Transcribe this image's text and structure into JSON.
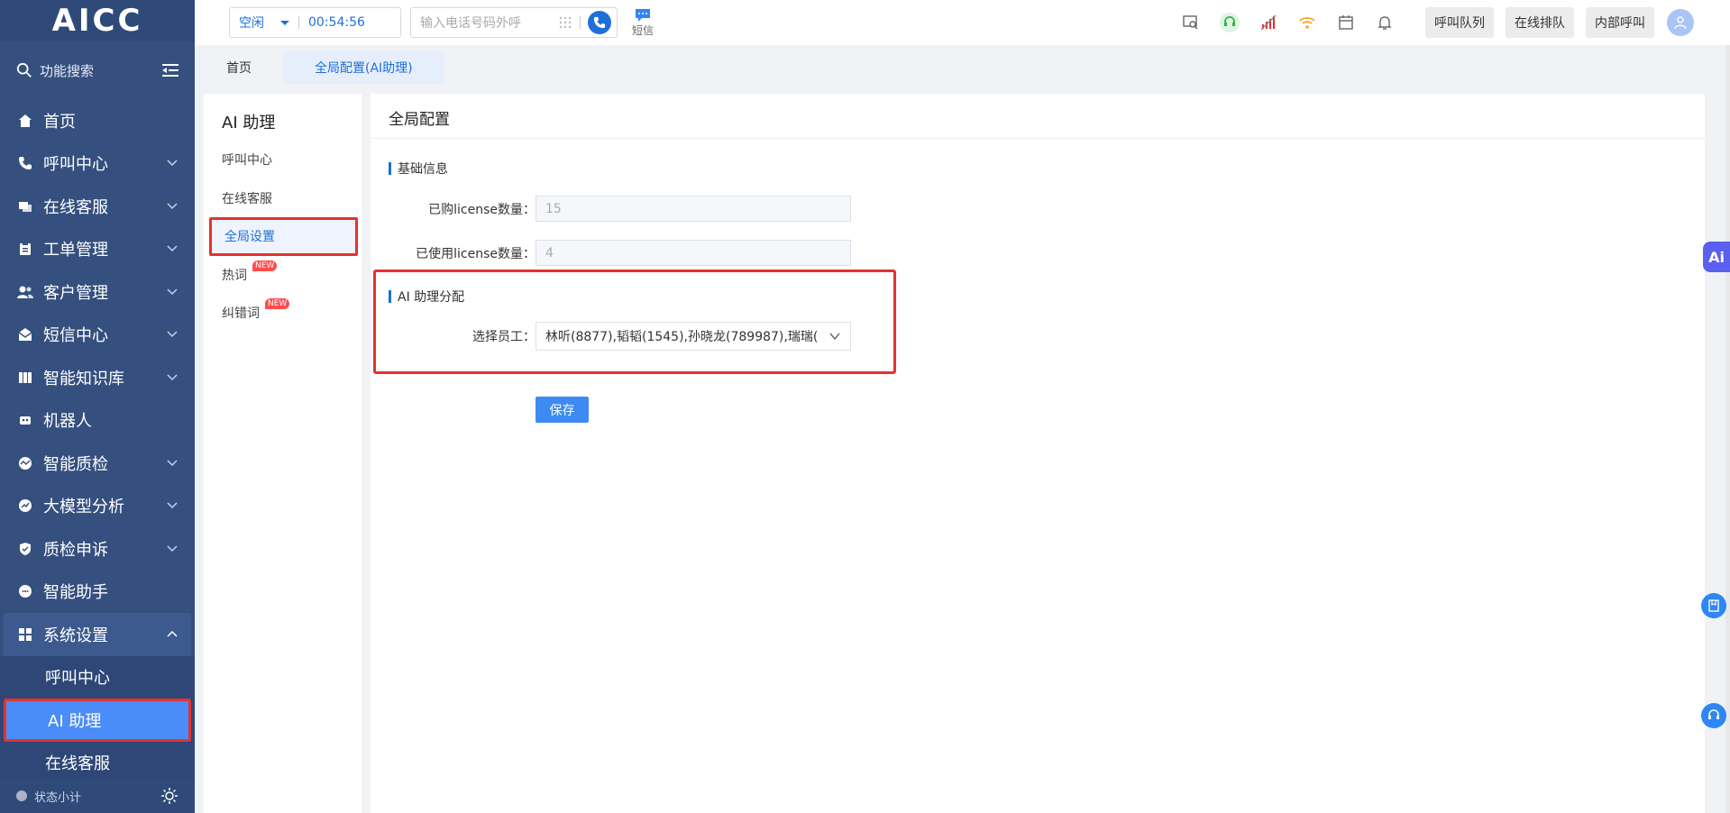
{
  "sidebar": {
    "logo": "AICC",
    "search_label": "功能搜索",
    "items": [
      {
        "label": "首页"
      },
      {
        "label": "呼叫中心"
      },
      {
        "label": "在线客服"
      },
      {
        "label": "工单管理"
      },
      {
        "label": "客户管理"
      },
      {
        "label": "短信中心"
      },
      {
        "label": "智能知识库"
      },
      {
        "label": "机器人"
      },
      {
        "label": "智能质检"
      },
      {
        "label": "大模型分析"
      },
      {
        "label": "质检申诉"
      },
      {
        "label": "智能助手"
      },
      {
        "label": "系统设置"
      }
    ],
    "submenu": [
      {
        "label": "呼叫中心"
      },
      {
        "label": "AI 助理"
      },
      {
        "label": "在线客服"
      }
    ],
    "status_label": "状态小计"
  },
  "header": {
    "agent_status": "空闲",
    "timer": "00:54:56",
    "dial_placeholder": "输入电话号码外呼",
    "sms_label": "短信",
    "buttons": [
      "呼叫队列",
      "在线排队",
      "内部呼叫"
    ]
  },
  "tabs": [
    {
      "label": "首页"
    },
    {
      "label": "全局配置(AI助理)"
    }
  ],
  "subpanel": {
    "title": "AI 助理",
    "items": [
      {
        "label": "呼叫中心"
      },
      {
        "label": "在线客服"
      },
      {
        "label": "全局设置"
      },
      {
        "label": "热词",
        "badge": "NEW"
      },
      {
        "label": "纠错词",
        "badge": "NEW"
      }
    ]
  },
  "main": {
    "title": "全局配置",
    "basic_section": "基础信息",
    "purchased_label": "已购license数量：",
    "purchased_value": "15",
    "used_label": "已使用license数量：",
    "used_value": "4",
    "ai_section": "AI 助理分配",
    "employee_label": "选择员工：",
    "employee_value": "林听(8877),韬韬(1545),孙晓龙(789987),瑞瑞(",
    "save_label": "保存"
  },
  "float": {
    "ai_label": "Ai"
  },
  "colors": {
    "sidebar": "#35507f",
    "accent": "#1e6fd9",
    "highlight": "#e5322d"
  }
}
